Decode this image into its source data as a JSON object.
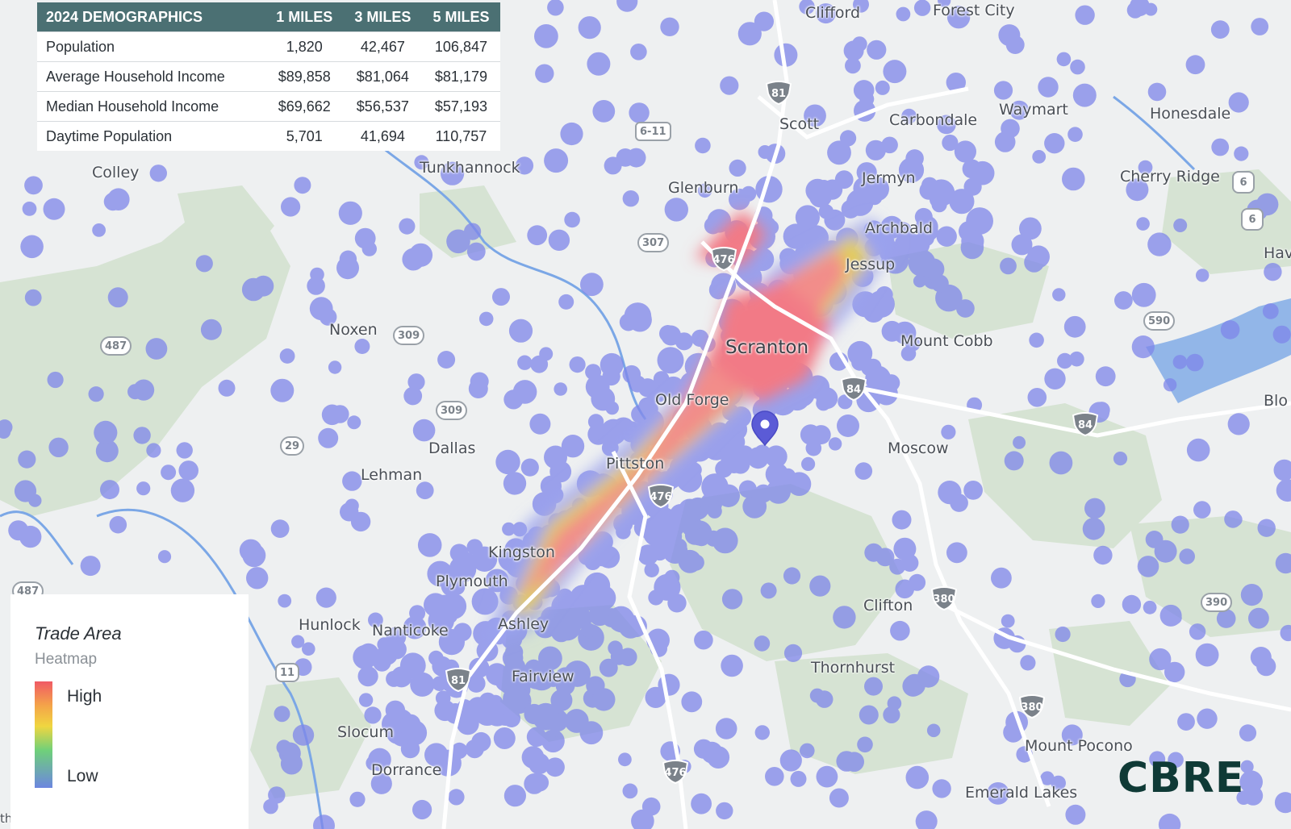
{
  "demographics": {
    "header": {
      "title": "2024 DEMOGRAPHICS",
      "col1": "1 MILES",
      "col2": "3 MILES",
      "col3": "5 MILES"
    },
    "rows": [
      {
        "label": "Population",
        "v1": "1,820",
        "v2": "42,467",
        "v3": "106,847"
      },
      {
        "label": "Average Household Income",
        "v1": "$89,858",
        "v2": "$81,064",
        "v3": "$81,179"
      },
      {
        "label": "Median Household Income",
        "v1": "$69,662",
        "v2": "$56,537",
        "v3": "$57,193"
      },
      {
        "label": "Daytime Population",
        "v1": "5,701",
        "v2": "41,694",
        "v3": "110,757"
      }
    ]
  },
  "legend": {
    "title": "Trade Area",
    "subtitle": "Heatmap",
    "high": "High",
    "low": "Low"
  },
  "brand": "CBRE",
  "places": {
    "clifford": "Clifford",
    "forest_city": "Forest City",
    "scott": "Scott",
    "carbondale": "Carbondale",
    "waymart": "Waymart",
    "honesdale": "Honesdale",
    "colley": "Colley",
    "tunkhannock": "Tunkhannock",
    "glenburn": "Glenburn",
    "jermyn": "Jermyn",
    "cherry_ridge": "Cherry Ridge",
    "archbald": "Archbald",
    "jessup": "Jessup",
    "hav": "Hav",
    "noxen": "Noxen",
    "scranton": "Scranton",
    "mount_cobb": "Mount Cobb",
    "old_forge": "Old Forge",
    "blo": "Blo",
    "dallas": "Dallas",
    "moscow": "Moscow",
    "pittston": "Pittston",
    "lehman": "Lehman",
    "kingston": "Kingston",
    "plymouth": "Plymouth",
    "clifton": "Clifton",
    "hunlock": "Hunlock",
    "nanticoke": "Nanticoke",
    "ashley": "Ashley",
    "thornhurst": "Thornhurst",
    "fairview": "Fairview",
    "slocum": "Slocum",
    "mount_pocono": "Mount Pocono",
    "dorrance": "Dorrance",
    "emerald_lakes": "Emerald Lakes",
    "th": "th"
  },
  "routes": {
    "r81a": "81",
    "r611": "6-11",
    "r6a": "6",
    "r6b": "6",
    "r307": "307",
    "r476a": "476",
    "r309a": "309",
    "r487a": "487",
    "r590": "590",
    "r84a": "84",
    "r309b": "309",
    "r84b": "84",
    "r29": "29",
    "r476b": "476",
    "r487b": "487",
    "r380a": "380",
    "r390": "390",
    "r11": "11",
    "r81b": "81",
    "r380b": "380",
    "r476c": "476"
  },
  "colors": {
    "header_bg": "#4b7073",
    "brand": "#0f3a36",
    "pin": "#5b5bd6"
  }
}
